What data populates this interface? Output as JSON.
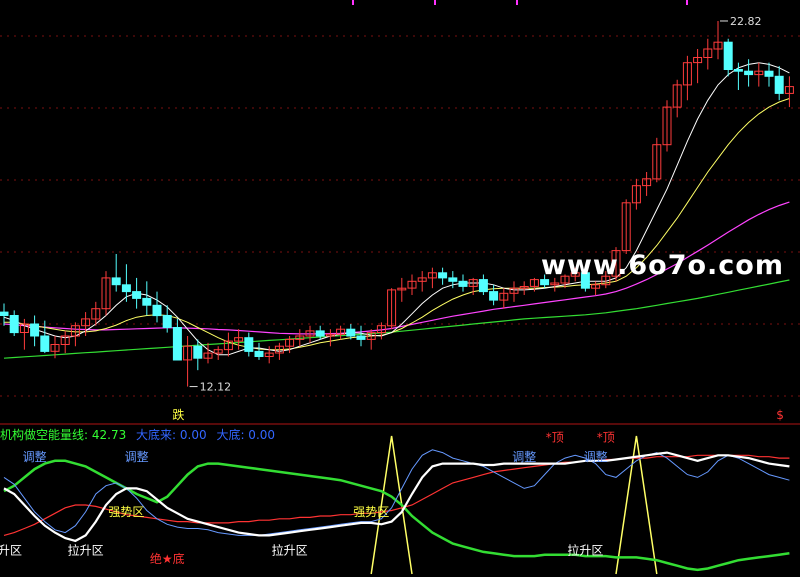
{
  "chart_data": [
    {
      "type": "candlestick",
      "title": "",
      "ylim": [
        11.2,
        23.2
      ],
      "grid": true,
      "colors": {
        "up": "#ff3c3c",
        "down": "#54ffff",
        "ma_white": "#ffffff",
        "ma_yellow": "#ffff66",
        "ma_magenta": "#ff44ff",
        "ma_green": "#33dd33"
      },
      "candles": [
        [
          14.3,
          14.55,
          13.9,
          14.2
        ],
        [
          14.2,
          14.35,
          13.6,
          13.7
        ],
        [
          13.7,
          14.1,
          13.2,
          13.95
        ],
        [
          13.95,
          14.2,
          13.3,
          13.6
        ],
        [
          13.6,
          14.05,
          13.1,
          13.15
        ],
        [
          13.15,
          13.6,
          12.95,
          13.35
        ],
        [
          13.35,
          13.75,
          13.1,
          13.6
        ],
        [
          13.6,
          14.0,
          13.3,
          13.9
        ],
        [
          13.9,
          14.3,
          13.6,
          14.1
        ],
        [
          14.1,
          14.6,
          13.9,
          14.4
        ],
        [
          14.4,
          15.5,
          14.2,
          15.3
        ],
        [
          15.3,
          16.0,
          14.9,
          15.1
        ],
        [
          15.1,
          15.7,
          14.6,
          14.9
        ],
        [
          14.9,
          15.3,
          14.4,
          14.7
        ],
        [
          14.7,
          15.2,
          14.2,
          14.5
        ],
        [
          14.5,
          14.9,
          14.0,
          14.2
        ],
        [
          14.2,
          14.5,
          13.7,
          13.85
        ],
        [
          13.85,
          14.1,
          12.9,
          12.9
        ],
        [
          12.9,
          13.6,
          12.12,
          13.3
        ],
        [
          13.3,
          13.5,
          12.6,
          12.95
        ],
        [
          12.95,
          13.4,
          12.8,
          13.1
        ],
        [
          13.1,
          13.3,
          12.9,
          13.2
        ],
        [
          13.2,
          13.7,
          13.0,
          13.45
        ],
        [
          13.45,
          13.8,
          13.2,
          13.55
        ],
        [
          13.55,
          13.7,
          13.0,
          13.15
        ],
        [
          13.15,
          13.4,
          12.9,
          13.0
        ],
        [
          13.0,
          13.3,
          12.8,
          13.1
        ],
        [
          13.1,
          13.4,
          12.9,
          13.3
        ],
        [
          13.3,
          13.6,
          13.1,
          13.5
        ],
        [
          13.5,
          13.8,
          13.3,
          13.6
        ],
        [
          13.6,
          13.9,
          13.4,
          13.75
        ],
        [
          13.75,
          13.9,
          13.5,
          13.6
        ],
        [
          13.6,
          13.8,
          13.3,
          13.65
        ],
        [
          13.65,
          13.9,
          13.5,
          13.8
        ],
        [
          13.8,
          13.95,
          13.5,
          13.6
        ],
        [
          13.6,
          13.9,
          13.3,
          13.5
        ],
        [
          13.5,
          13.8,
          13.2,
          13.7
        ],
        [
          13.7,
          14.0,
          13.5,
          13.9
        ],
        [
          13.9,
          15.0,
          13.8,
          14.95
        ],
        [
          14.95,
          15.3,
          14.6,
          15.0
        ],
        [
          15.0,
          15.4,
          14.8,
          15.2
        ],
        [
          15.2,
          15.5,
          14.9,
          15.3
        ],
        [
          15.3,
          15.6,
          15.0,
          15.45
        ],
        [
          15.45,
          15.6,
          15.1,
          15.3
        ],
        [
          15.3,
          15.5,
          15.0,
          15.2
        ],
        [
          15.2,
          15.4,
          14.9,
          15.05
        ],
        [
          15.05,
          15.3,
          14.8,
          15.25
        ],
        [
          15.25,
          15.4,
          14.8,
          14.9
        ],
        [
          14.9,
          15.1,
          14.5,
          14.65
        ],
        [
          14.65,
          15.0,
          14.4,
          14.85
        ],
        [
          14.85,
          15.2,
          14.6,
          15.0
        ],
        [
          15.0,
          15.2,
          14.8,
          15.05
        ],
        [
          15.05,
          15.3,
          14.9,
          15.25
        ],
        [
          15.25,
          15.4,
          15.0,
          15.1
        ],
        [
          15.1,
          15.3,
          14.9,
          15.15
        ],
        [
          15.15,
          15.4,
          15.0,
          15.35
        ],
        [
          15.35,
          15.6,
          15.2,
          15.45
        ],
        [
          15.45,
          15.6,
          14.9,
          15.0
        ],
        [
          15.0,
          15.2,
          14.8,
          15.1
        ],
        [
          15.1,
          15.5,
          15.0,
          15.35
        ],
        [
          15.35,
          16.2,
          15.2,
          16.1
        ],
        [
          16.1,
          17.6,
          16.0,
          17.5
        ],
        [
          17.5,
          18.2,
          17.3,
          18.0
        ],
        [
          18.0,
          18.4,
          17.7,
          18.2
        ],
        [
          18.2,
          19.4,
          18.1,
          19.2
        ],
        [
          19.2,
          20.5,
          19.0,
          20.3
        ],
        [
          20.3,
          21.1,
          20.0,
          20.95
        ],
        [
          20.95,
          21.8,
          20.5,
          21.6
        ],
        [
          21.6,
          22.0,
          21.0,
          21.75
        ],
        [
          21.75,
          22.3,
          21.4,
          22.0
        ],
        [
          22.0,
          22.82,
          21.7,
          22.2
        ],
        [
          22.2,
          22.3,
          21.2,
          21.4
        ],
        [
          21.4,
          21.6,
          20.8,
          21.35
        ],
        [
          21.35,
          21.7,
          20.9,
          21.25
        ],
        [
          21.25,
          21.6,
          20.9,
          21.35
        ],
        [
          21.35,
          21.6,
          20.9,
          21.2
        ],
        [
          21.2,
          21.5,
          20.5,
          20.7
        ],
        [
          20.7,
          21.2,
          20.3,
          20.9
        ]
      ],
      "ma_white": [
        14.15,
        14.05,
        13.9,
        13.8,
        13.7,
        13.6,
        13.55,
        13.6,
        13.75,
        13.95,
        14.2,
        14.5,
        14.75,
        14.85,
        14.8,
        14.65,
        14.45,
        14.15,
        13.8,
        13.45,
        13.2,
        13.05,
        13.05,
        13.15,
        13.25,
        13.25,
        13.2,
        13.15,
        13.2,
        13.3,
        13.4,
        13.5,
        13.6,
        13.65,
        13.7,
        13.68,
        13.62,
        13.6,
        13.7,
        13.95,
        14.25,
        14.55,
        14.8,
        15.0,
        15.1,
        15.15,
        15.15,
        15.15,
        15.1,
        15.0,
        14.95,
        14.95,
        14.97,
        15.0,
        15.05,
        15.1,
        15.15,
        15.2,
        15.2,
        15.2,
        15.3,
        15.6,
        16.1,
        16.7,
        17.3,
        17.9,
        18.6,
        19.3,
        19.95,
        20.5,
        20.95,
        21.25,
        21.45,
        21.55,
        21.6,
        21.55,
        21.45,
        21.3
      ],
      "ma_yellow": [
        14.0,
        14.0,
        13.95,
        13.9,
        13.85,
        13.8,
        13.75,
        13.72,
        13.72,
        13.75,
        13.82,
        13.92,
        14.05,
        14.15,
        14.2,
        14.22,
        14.2,
        14.12,
        14.0,
        13.85,
        13.7,
        13.55,
        13.42,
        13.33,
        13.27,
        13.22,
        13.2,
        13.2,
        13.22,
        13.27,
        13.33,
        13.4,
        13.45,
        13.5,
        13.55,
        13.58,
        13.6,
        13.62,
        13.7,
        13.82,
        13.98,
        14.15,
        14.35,
        14.52,
        14.68,
        14.8,
        14.9,
        14.95,
        14.98,
        15.0,
        15.0,
        15.0,
        15.0,
        15.02,
        15.03,
        15.05,
        15.08,
        15.1,
        15.12,
        15.15,
        15.2,
        15.35,
        15.6,
        15.9,
        16.25,
        16.65,
        17.05,
        17.5,
        17.95,
        18.4,
        18.8,
        19.2,
        19.55,
        19.85,
        20.1,
        20.3,
        20.45,
        20.55
      ],
      "ma_magenta": [
        13.95,
        13.93,
        13.9,
        13.88,
        13.86,
        13.84,
        13.82,
        13.8,
        13.79,
        13.78,
        13.78,
        13.79,
        13.8,
        13.81,
        13.82,
        13.83,
        13.84,
        13.84,
        13.83,
        13.82,
        13.81,
        13.79,
        13.78,
        13.76,
        13.74,
        13.72,
        13.7,
        13.68,
        13.67,
        13.66,
        13.66,
        13.66,
        13.67,
        13.68,
        13.7,
        13.72,
        13.75,
        13.78,
        13.82,
        13.88,
        13.94,
        14.0,
        14.06,
        14.12,
        14.18,
        14.23,
        14.28,
        14.33,
        14.38,
        14.42,
        14.46,
        14.5,
        14.54,
        14.58,
        14.62,
        14.66,
        14.7,
        14.74,
        14.78,
        14.83,
        14.9,
        15.0,
        15.12,
        15.25,
        15.4,
        15.56,
        15.72,
        15.9,
        16.08,
        16.26,
        16.45,
        16.64,
        16.82,
        17.0,
        17.16,
        17.3,
        17.42,
        17.52
      ],
      "ma_green": [
        12.95,
        12.97,
        12.99,
        13.01,
        13.03,
        13.05,
        13.07,
        13.09,
        13.11,
        13.13,
        13.15,
        13.17,
        13.19,
        13.21,
        13.23,
        13.25,
        13.27,
        13.29,
        13.31,
        13.33,
        13.35,
        13.37,
        13.39,
        13.41,
        13.43,
        13.45,
        13.47,
        13.49,
        13.51,
        13.53,
        13.55,
        13.57,
        13.59,
        13.61,
        13.63,
        13.65,
        13.67,
        13.69,
        13.71,
        13.74,
        13.77,
        13.8,
        13.83,
        13.86,
        13.89,
        13.92,
        13.95,
        13.98,
        14.01,
        14.04,
        14.07,
        14.1,
        14.12,
        14.14,
        14.16,
        14.18,
        14.2,
        14.22,
        14.25,
        14.28,
        14.32,
        14.36,
        14.4,
        14.45,
        14.5,
        14.55,
        14.6,
        14.65,
        14.7,
        14.76,
        14.82,
        14.88,
        14.94,
        15.0,
        15.06,
        15.12,
        15.18,
        15.24
      ],
      "annotations": {
        "high": {
          "index": 70,
          "price": 22.82,
          "label": "22.82"
        },
        "low": {
          "index": 18,
          "price": 12.12,
          "label": "12.12"
        },
        "signal_die": {
          "index": 17,
          "label": "跌",
          "color": "#ffff44"
        },
        "signal_dollar": {
          "index": 76,
          "label": "$",
          "color": "#ff3333"
        }
      }
    },
    {
      "type": "line",
      "ylim": [
        0,
        100
      ],
      "title_items": [
        {
          "text": "机构做空能量线: 42.73",
          "color": "#33ff33"
        },
        {
          "text": "大底来: 0.00",
          "color": "#3366ff"
        },
        {
          "text": "大底: 0.00",
          "color": "#3366ff"
        }
      ],
      "series": [
        {
          "color": "#ffffff",
          "width": 2.2,
          "values": [
            62,
            58,
            50,
            42,
            35,
            30,
            26,
            24,
            28,
            38,
            50,
            58,
            62,
            62,
            60,
            54,
            48,
            44,
            40,
            38,
            36,
            34,
            32,
            30,
            29,
            28,
            28,
            29,
            30,
            31,
            32,
            33,
            34,
            35,
            36,
            37,
            37,
            36,
            38,
            45,
            58,
            70,
            78,
            80,
            80,
            80,
            80,
            79,
            79,
            80,
            80,
            80,
            80,
            80,
            80,
            80,
            81,
            82,
            82,
            82,
            83,
            84,
            85,
            86,
            87,
            88,
            86,
            84,
            82,
            84,
            86,
            86,
            85,
            84,
            82,
            80,
            79,
            78
          ]
        },
        {
          "color": "#ff3333",
          "width": 1.2,
          "values": [
            28,
            30,
            33,
            36,
            40,
            44,
            48,
            50,
            50,
            49,
            47,
            45,
            43,
            42,
            41,
            40,
            39,
            38,
            38,
            37,
            37,
            37,
            37,
            38,
            38,
            39,
            39,
            40,
            40,
            41,
            41,
            42,
            42,
            43,
            43,
            44,
            44,
            45,
            46,
            48,
            50,
            54,
            58,
            62,
            66,
            68,
            70,
            72,
            74,
            75,
            76,
            77,
            78,
            79,
            80,
            81,
            81,
            82,
            82,
            83,
            83,
            84,
            84,
            84,
            85,
            85,
            85,
            85,
            86,
            86,
            86,
            86,
            86,
            86,
            85,
            85,
            84,
            84
          ]
        },
        {
          "color": "#6699ff",
          "width": 1.0,
          "values": [
            70,
            65,
            55,
            45,
            38,
            32,
            30,
            35,
            45,
            58,
            64,
            66,
            62,
            55,
            46,
            40,
            36,
            34,
            33,
            33,
            32,
            30,
            29,
            28,
            28,
            28,
            29,
            30,
            31,
            32,
            33,
            34,
            35,
            36,
            37,
            38,
            38,
            40,
            48,
            62,
            76,
            86,
            90,
            88,
            84,
            82,
            80,
            78,
            74,
            70,
            66,
            62,
            64,
            72,
            80,
            84,
            86,
            84,
            80,
            72,
            70,
            76,
            82,
            86,
            88,
            84,
            78,
            72,
            70,
            74,
            82,
            86,
            84,
            80,
            76,
            72,
            70,
            68
          ]
        },
        {
          "color": "#33dd33",
          "width": 2.5,
          "values": [
            60,
            64,
            70,
            76,
            80,
            82,
            82,
            80,
            78,
            74,
            70,
            66,
            62,
            58,
            55,
            52,
            56,
            64,
            72,
            78,
            80,
            80,
            79,
            78,
            77,
            76,
            75,
            74,
            73,
            72,
            71,
            70,
            69,
            68,
            66,
            64,
            62,
            60,
            56,
            50,
            42,
            36,
            30,
            26,
            22,
            20,
            18,
            16,
            15,
            14,
            13,
            13,
            13,
            14,
            14,
            14,
            14,
            13,
            13,
            13,
            12,
            12,
            12,
            11,
            10,
            8,
            6,
            4,
            3,
            4,
            6,
            8,
            10,
            11,
            12,
            13,
            14,
            15
          ]
        }
      ],
      "spikes": [
        {
          "start": 36,
          "peak": 38,
          "end": 40,
          "color": "#ffff66"
        },
        {
          "start": 60,
          "peak": 62,
          "end": 64,
          "color": "#ffff66"
        }
      ],
      "labels": [
        {
          "index": 3,
          "value": 82,
          "text": "调整",
          "color": "#6699ff"
        },
        {
          "index": 13,
          "value": 82,
          "text": "调整",
          "color": "#6699ff"
        },
        {
          "index": 51,
          "value": 82,
          "text": "调整",
          "color": "#6699ff"
        },
        {
          "index": 58,
          "value": 82,
          "text": "调整",
          "color": "#6699ff"
        },
        {
          "index": 12,
          "value": 42,
          "text": "强势区",
          "color": "#ffff44"
        },
        {
          "index": 36,
          "value": 42,
          "text": "强势区",
          "color": "#ffff44"
        },
        {
          "index": 54,
          "value": 96,
          "text": "*顶",
          "color": "#ff3333"
        },
        {
          "index": 59,
          "value": 96,
          "text": "*顶",
          "color": "#ff3333"
        },
        {
          "index": 0,
          "value": 14,
          "text": "拉升区",
          "color": "#ffffff"
        },
        {
          "index": 8,
          "value": 14,
          "text": "拉升区",
          "color": "#ffffff"
        },
        {
          "index": 28,
          "value": 14,
          "text": "拉升区",
          "color": "#ffffff"
        },
        {
          "index": 57,
          "value": 14,
          "text": "拉升区",
          "color": "#ffffff"
        },
        {
          "index": 16,
          "value": 8,
          "text": "绝★底",
          "color": "#ff3333"
        }
      ]
    }
  ],
  "watermark": {
    "text": "www.6o7o.com"
  }
}
